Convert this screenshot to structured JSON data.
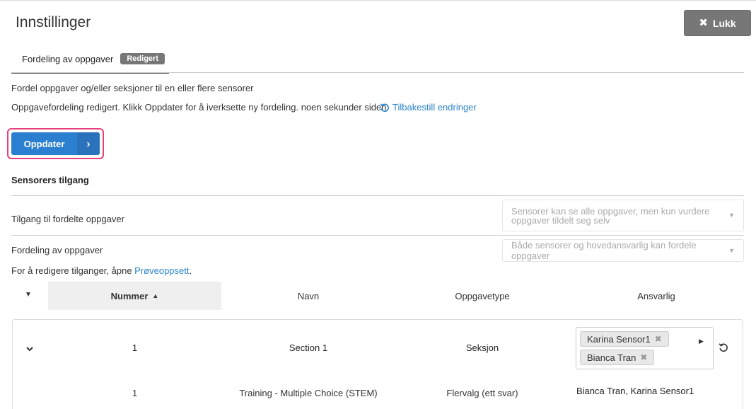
{
  "page": {
    "title": "Innstillinger",
    "close_label": "Lukk"
  },
  "tabs": [
    {
      "label": "Fordeling av oppgaver",
      "badge": "Redigert"
    }
  ],
  "description": "Fordel oppgaver og/eller seksjoner til en eller flere sensorer",
  "status_text": "Oppgavefordeling redigert. Klikk Oppdater for å iverksette ny fordeling. noen sekunder siden",
  "reset_label": "Tilbakestill endringer",
  "update_label": "Oppdater",
  "access": {
    "heading": "Sensorers tilgang",
    "rows": [
      {
        "label": "Tilgang til fordelte oppgaver",
        "value": "Sensorer kan se alle oppgaver, men kun vurdere oppgaver tildelt seg selv"
      },
      {
        "label": "Fordeling av oppgaver",
        "value": "Både sensorer og hovedansvarlig kan fordele oppgaver"
      }
    ],
    "note_prefix": "For å redigere tilganger, åpne ",
    "note_link": "Prøveoppsett",
    "note_suffix": "."
  },
  "table": {
    "columns": [
      "Nummer",
      "Navn",
      "Oppgavetype",
      "Ansvarlig"
    ],
    "sections": [
      {
        "number": "1",
        "name": "Section 1",
        "type": "Seksjon",
        "assignees": [
          "Karina Sensor1",
          "Bianca Tran"
        ],
        "tasks": [
          {
            "number": "1",
            "name": "Training - Multiple Choice (STEM)",
            "type": "Flervalg (ett svar)",
            "responsible": "Bianca Tran, Karina Sensor1"
          }
        ]
      }
    ]
  },
  "colors": {
    "primary": "#2b7fd0",
    "link": "#2a84c9",
    "highlight": "#e8407a",
    "badge": "#777777"
  }
}
